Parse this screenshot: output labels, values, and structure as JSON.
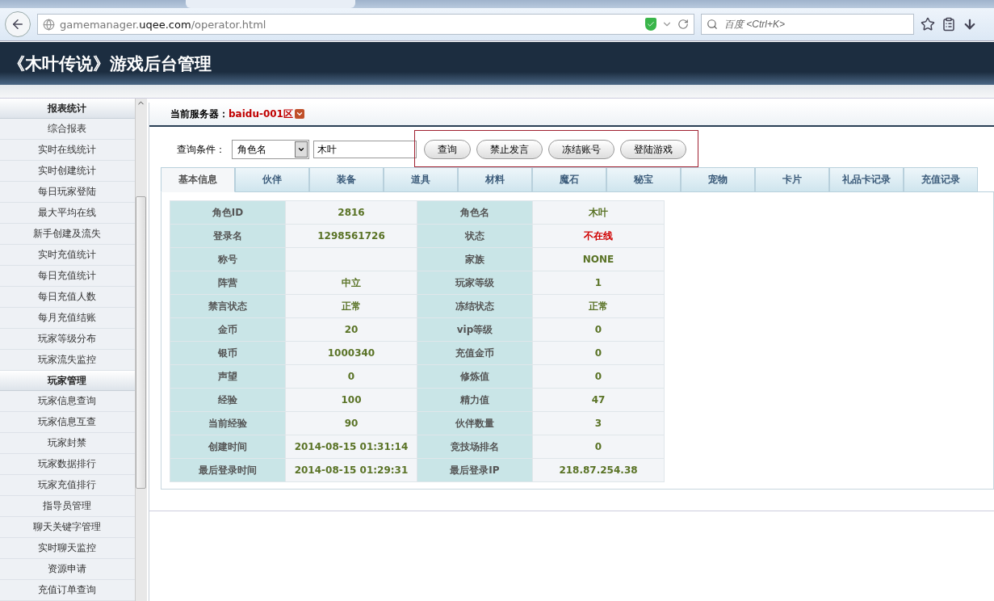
{
  "browser": {
    "url": {
      "prefix": "gamemanager.",
      "domain": "uqee.com",
      "path": "/operator.html"
    },
    "search": {
      "placeholder": "百度 <Ctrl+K>"
    }
  },
  "header": {
    "title": "《木叶传说》游戏后台管理"
  },
  "sidebar": {
    "sections": [
      {
        "title": "报表统计",
        "items": [
          "综合报表",
          "实时在线统计",
          "实时创建统计",
          "每日玩家登陆",
          "最大平均在线",
          "新手创建及流失",
          "实时充值统计",
          "每日充值统计",
          "每日充值人数",
          "每月充值结账",
          "玩家等级分布",
          "玩家流失监控"
        ]
      },
      {
        "title": "玩家管理",
        "items": [
          "玩家信息查询",
          "玩家信息互查",
          "玩家封禁",
          "玩家数据排行",
          "玩家充值排行",
          "指导员管理",
          "聊天关键字管理",
          "实时聊天监控",
          "资源申请",
          "充值订单查询"
        ]
      }
    ]
  },
  "server": {
    "label": "当前服务器：",
    "value": "baidu-001区"
  },
  "query": {
    "label": "查询条件：",
    "select": "角色名",
    "value": "木叶",
    "buttons": [
      "查询",
      "禁止发言",
      "冻结账号",
      "登陆游戏"
    ]
  },
  "tabs": [
    {
      "label": "基本信息",
      "selected": true
    },
    {
      "label": "伙伴",
      "selected": false
    },
    {
      "label": "装备",
      "selected": false
    },
    {
      "label": "道具",
      "selected": false
    },
    {
      "label": "材料",
      "selected": false
    },
    {
      "label": "魔石",
      "selected": false
    },
    {
      "label": "秘宝",
      "selected": false
    },
    {
      "label": "宠物",
      "selected": false
    },
    {
      "label": "卡片",
      "selected": false
    },
    {
      "label": "礼品卡记录",
      "selected": false
    },
    {
      "label": "充值记录",
      "selected": false
    }
  ],
  "info_rows": [
    [
      {
        "label": "角色ID",
        "value": "2816",
        "alert": false
      },
      {
        "label": "角色名",
        "value": "木叶",
        "alert": false
      }
    ],
    [
      {
        "label": "登录名",
        "value": "1298561726",
        "alert": false
      },
      {
        "label": "状态",
        "value": "不在线",
        "alert": true
      }
    ],
    [
      {
        "label": "称号"
      },
      {
        "label": "家族",
        "value": "NONE",
        "alert": false
      }
    ],
    [
      {
        "label": "阵营",
        "value": "中立",
        "alert": false
      },
      {
        "label": "玩家等级",
        "value": "1",
        "alert": false
      }
    ],
    [
      {
        "label": "禁言状态",
        "value": "正常",
        "alert": false
      },
      {
        "label": "冻结状态",
        "value": "正常",
        "alert": false
      }
    ],
    [
      {
        "label": "金币",
        "value": "20",
        "alert": false
      },
      {
        "label": "vip等级",
        "value": "0",
        "alert": false
      }
    ],
    [
      {
        "label": "银币",
        "value": "1000340",
        "alert": false
      },
      {
        "label": "充值金币",
        "value": "0",
        "alert": false
      }
    ],
    [
      {
        "label": "声望",
        "value": "0",
        "alert": false
      },
      {
        "label": "修炼值",
        "value": "0",
        "alert": false
      }
    ],
    [
      {
        "label": "经验",
        "value": "100",
        "alert": false
      },
      {
        "label": "精力值",
        "value": "47",
        "alert": false
      }
    ],
    [
      {
        "label": "当前经验",
        "value": "90",
        "alert": false
      },
      {
        "label": "伙伴数量",
        "value": "3",
        "alert": false
      }
    ],
    [
      {
        "label": "创建时间",
        "value": "2014-08-15 01:31:14",
        "alert": false
      },
      {
        "label": "竞技场排名",
        "value": "0",
        "alert": false
      }
    ],
    [
      {
        "label": "最后登录时间",
        "value": "2014-08-15 01:29:31",
        "alert": false
      },
      {
        "label": "最后登录IP",
        "value": "218.87.254.38",
        "alert": false
      }
    ]
  ]
}
